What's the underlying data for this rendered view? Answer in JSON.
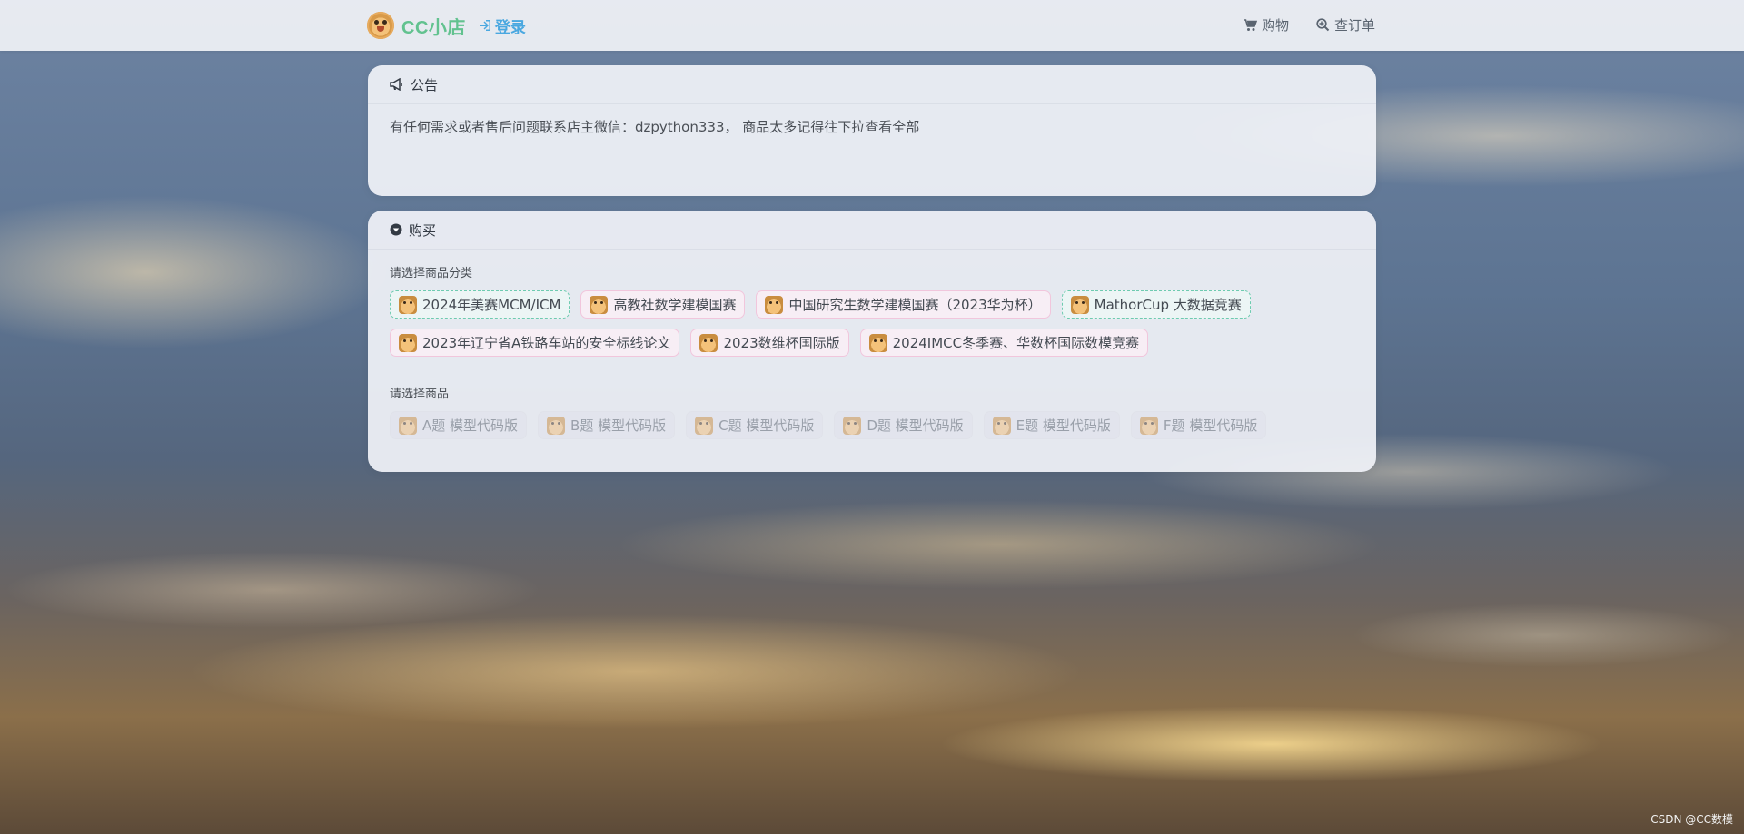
{
  "navbar": {
    "brand_name": "CC小店",
    "login_label": "登录",
    "links": [
      {
        "label": "购物",
        "icon": "cart-icon"
      },
      {
        "label": "查订单",
        "icon": "search-plus-icon"
      }
    ]
  },
  "notice": {
    "title": "公告",
    "text": "有任何需求或者售后问题联系店主微信：dzpython333， 商品太多记得往下拉查看全部"
  },
  "buy": {
    "title": "购买",
    "category_label": "请选择商品分类",
    "categories": [
      {
        "label": "2024年美赛MCM/ICM",
        "style": "dashed"
      },
      {
        "label": "高教社数学建模国赛",
        "style": "normal"
      },
      {
        "label": "中国研究生数学建模国赛（2023华为杯）",
        "style": "normal"
      },
      {
        "label": "MathorCup 大数据竞赛",
        "style": "dashed"
      },
      {
        "label": "2023年辽宁省A铁路车站的安全标线论文",
        "style": "normal"
      },
      {
        "label": "2023数维杯国际版",
        "style": "normal"
      },
      {
        "label": "2024IMCC冬季赛、华数杯国际数模竞赛",
        "style": "normal"
      }
    ],
    "product_label": "请选择商品",
    "products": [
      {
        "label": "A题 模型代码版"
      },
      {
        "label": "B题 模型代码版"
      },
      {
        "label": "C题 模型代码版"
      },
      {
        "label": "D题 模型代码版"
      },
      {
        "label": "E题 模型代码版"
      },
      {
        "label": "F题 模型代码版"
      }
    ]
  },
  "watermark": "CSDN @CC数模",
  "colors": {
    "brand": "#62c28f",
    "login": "#4aa8e0",
    "chip_border_pink": "#f1c6dc",
    "chip_border_teal": "#6ecbb0"
  }
}
